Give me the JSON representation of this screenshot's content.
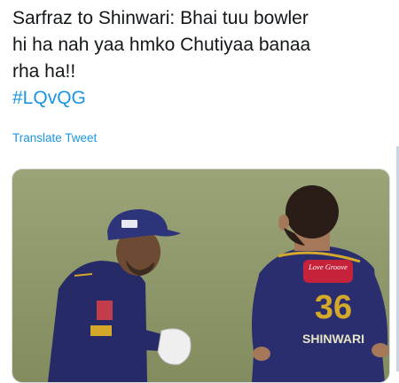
{
  "tweet": {
    "text_lines": [
      "Sarfraz to Shinwari: Bhai tuu bowler",
      "hi ha nah yaa hmko Chutiyaa banaa",
      "rha ha!!"
    ],
    "hashtag": "#LQvQG",
    "translate_label": "Translate Tweet"
  },
  "media": {
    "sponsor_badge": "Love Groove",
    "jersey_number": "36",
    "jersey_name": "SHINWARI",
    "colors": {
      "field": "#8f9a6a",
      "jersey": "#2b2f6e",
      "cap": "#2e3479",
      "accent": "#d4a82a"
    }
  }
}
